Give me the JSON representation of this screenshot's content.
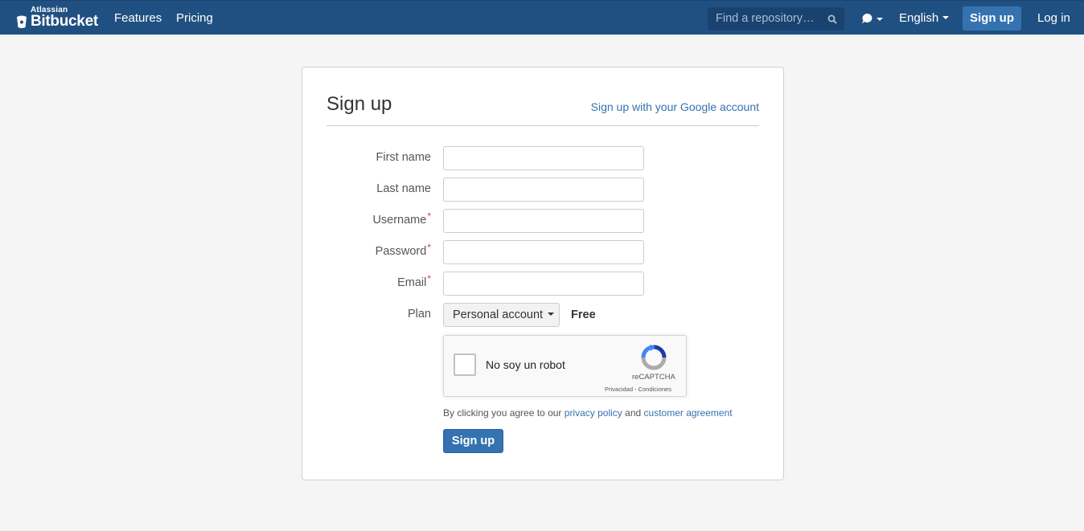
{
  "nav": {
    "brand_small": "Atlassian",
    "brand_name": "Bitbucket",
    "links": [
      "Features",
      "Pricing"
    ],
    "search_placeholder": "Find a repository…",
    "language": "English",
    "signup_label": "Sign up",
    "login_label": "Log in"
  },
  "form": {
    "title": "Sign up",
    "google_link": "Sign up with your Google account",
    "fields": [
      {
        "label": "First name",
        "required": false,
        "value": ""
      },
      {
        "label": "Last name",
        "required": false,
        "value": ""
      },
      {
        "label": "Username",
        "required": true,
        "value": ""
      },
      {
        "label": "Password",
        "required": true,
        "value": ""
      },
      {
        "label": "Email",
        "required": true,
        "value": ""
      }
    ],
    "required_marker": "*",
    "plan_label": "Plan",
    "plan_value": "Personal account",
    "plan_price": "Free",
    "captcha": {
      "text": "No soy un robot",
      "brand": "reCAPTCHA",
      "terms": "Privacidad - Condiciones"
    },
    "agree_prefix": "By clicking you agree to our",
    "privacy_link": "privacy policy",
    "agree_and": "and",
    "agreement_link": "customer agreement",
    "submit_label": "Sign up"
  },
  "colors": {
    "nav_bg": "#205081",
    "primary": "#3572b0",
    "required": "#d04437"
  }
}
